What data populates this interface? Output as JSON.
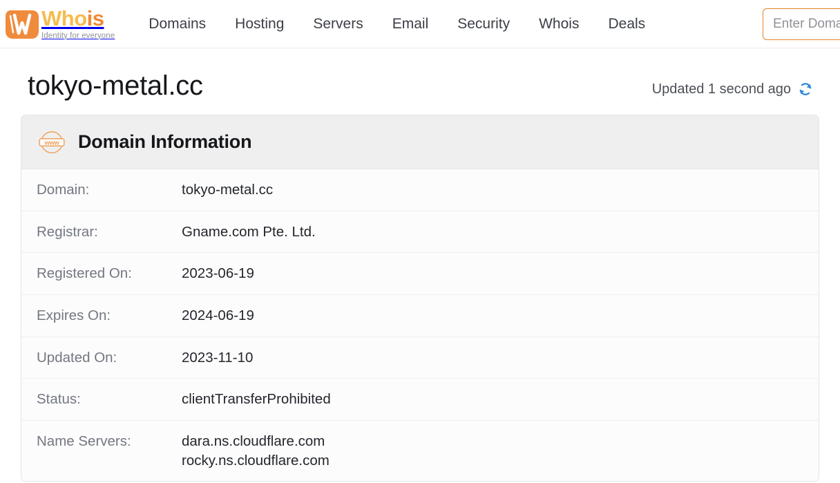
{
  "brand": {
    "logo_icon": "whois-w-logo",
    "word_part1": "Who",
    "word_part2": "is",
    "tagline": "Identity for everyone",
    "accent_light": "#f6bc4f",
    "accent_dark": "#f08a33"
  },
  "nav": {
    "items": [
      {
        "label": "Domains"
      },
      {
        "label": "Hosting"
      },
      {
        "label": "Servers"
      },
      {
        "label": "Email"
      },
      {
        "label": "Security"
      },
      {
        "label": "Whois"
      },
      {
        "label": "Deals"
      }
    ],
    "search": {
      "placeholder": "Enter Domain Name",
      "value": "",
      "border_color": "#e8832a"
    }
  },
  "page": {
    "title": "tokyo-metal.cc",
    "updated_text": "Updated 1 second ago",
    "refresh_icon": "refresh-icon",
    "refresh_color": "#2e86d8"
  },
  "card": {
    "icon": "www-globe-icon",
    "title": "Domain Information",
    "header_bg": "#efefef",
    "rows": [
      {
        "label": "Domain:",
        "value": "tokyo-metal.cc"
      },
      {
        "label": "Registrar:",
        "value": "Gname.com Pte. Ltd."
      },
      {
        "label": "Registered On:",
        "value": "2023-06-19"
      },
      {
        "label": "Expires On:",
        "value": "2024-06-19"
      },
      {
        "label": "Updated On:",
        "value": "2023-11-10"
      },
      {
        "label": "Status:",
        "value": "clientTransferProhibited"
      },
      {
        "label": "Name Servers:",
        "value_lines": [
          "dara.ns.cloudflare.com",
          "rocky.ns.cloudflare.com"
        ]
      }
    ]
  }
}
